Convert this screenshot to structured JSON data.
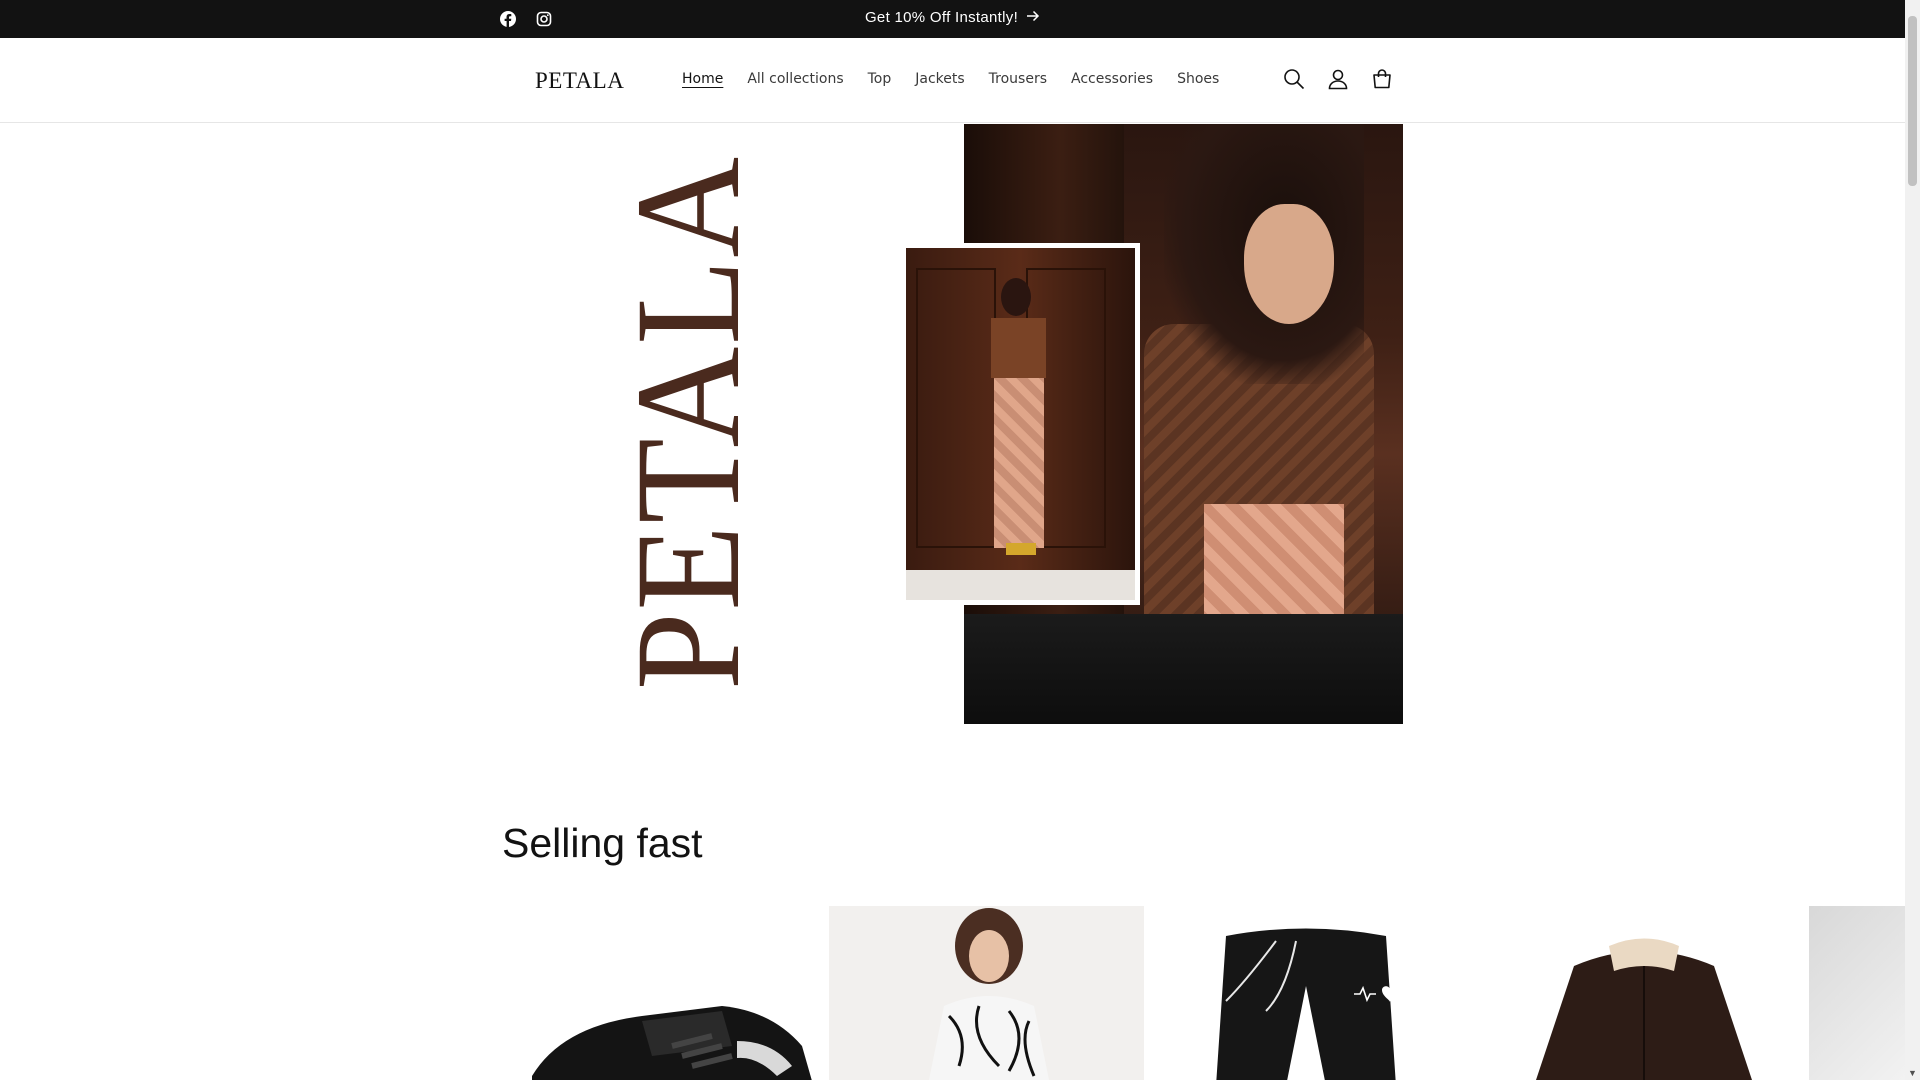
{
  "announcement": {
    "promo_text": "Get 10% Off Instantly!",
    "social": [
      "facebook-icon",
      "instagram-icon"
    ]
  },
  "header": {
    "logo": "PETALA",
    "nav": [
      {
        "label": "Home",
        "active": true
      },
      {
        "label": "All collections",
        "active": false
      },
      {
        "label": "Top",
        "active": false
      },
      {
        "label": "Jackets",
        "active": false
      },
      {
        "label": "Trousers",
        "active": false
      },
      {
        "label": "Accessories",
        "active": false
      },
      {
        "label": "Shoes",
        "active": false
      }
    ],
    "icons": [
      "search-icon",
      "account-icon",
      "cart-icon"
    ]
  },
  "hero": {
    "vertical_brand": "PETALA",
    "brand_color": "#4a2a1e"
  },
  "selling_fast": {
    "title": "Selling fast"
  },
  "colors": {
    "announcement_bg": "#121212",
    "text": "#121212"
  }
}
